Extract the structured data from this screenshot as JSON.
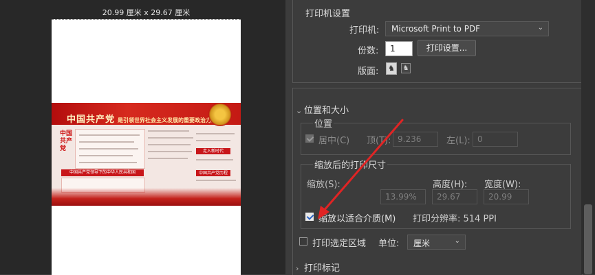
{
  "preview": {
    "paper_size": "20.99 厘米 x 29.67 厘米",
    "poster": {
      "title_main": "中国共产党",
      "title_sub": "是引领世界社会主义发展的重要政治力量",
      "left_column": "中国共产党",
      "red_bar_1": "中国共产党领导下的中华人民共和国",
      "red_bar_2": "走入新时代",
      "red_bar_3": "中国共产党历程"
    }
  },
  "printer_settings": {
    "title": "打印机设置",
    "printer_label": "打印机:",
    "printer_value": "Microsoft Print to PDF",
    "copies_label": "份数:",
    "copies_value": "1",
    "print_setup_button": "打印设置...",
    "layout_label": "版面:"
  },
  "position_size": {
    "title": "位置和大小",
    "position": {
      "title": "位置",
      "center_label": "居中(C)",
      "top_label": "顶(T):",
      "top_value": "9.236",
      "left_label": "左(L):",
      "left_value": "0"
    },
    "scaled": {
      "title": "缩放后的打印尺寸",
      "scale_label": "缩放(S):",
      "scale_value": "13.99%",
      "height_label": "高度(H):",
      "height_value": "29.67",
      "width_label": "宽度(W):",
      "width_value": "20.99",
      "fit_media_label": "缩放以适合介质(M)",
      "resolution": "打印分辨率: 514 PPI"
    }
  },
  "print_selected": {
    "label": "打印选定区域",
    "unit_label": "单位:",
    "unit_value": "厘米"
  },
  "print_marks": {
    "title": "打印标记"
  },
  "icons": {
    "chevron_down": "chevron-down-icon",
    "chevron_right": "chevron-right-icon",
    "portrait": "portrait-orientation-icon",
    "landscape": "landscape-orientation-icon"
  },
  "colors": {
    "panel_bg": "#3c3c3c",
    "preview_bg": "#282828",
    "annotation_arrow": "#e02424",
    "poster_red": "#c8161a"
  }
}
